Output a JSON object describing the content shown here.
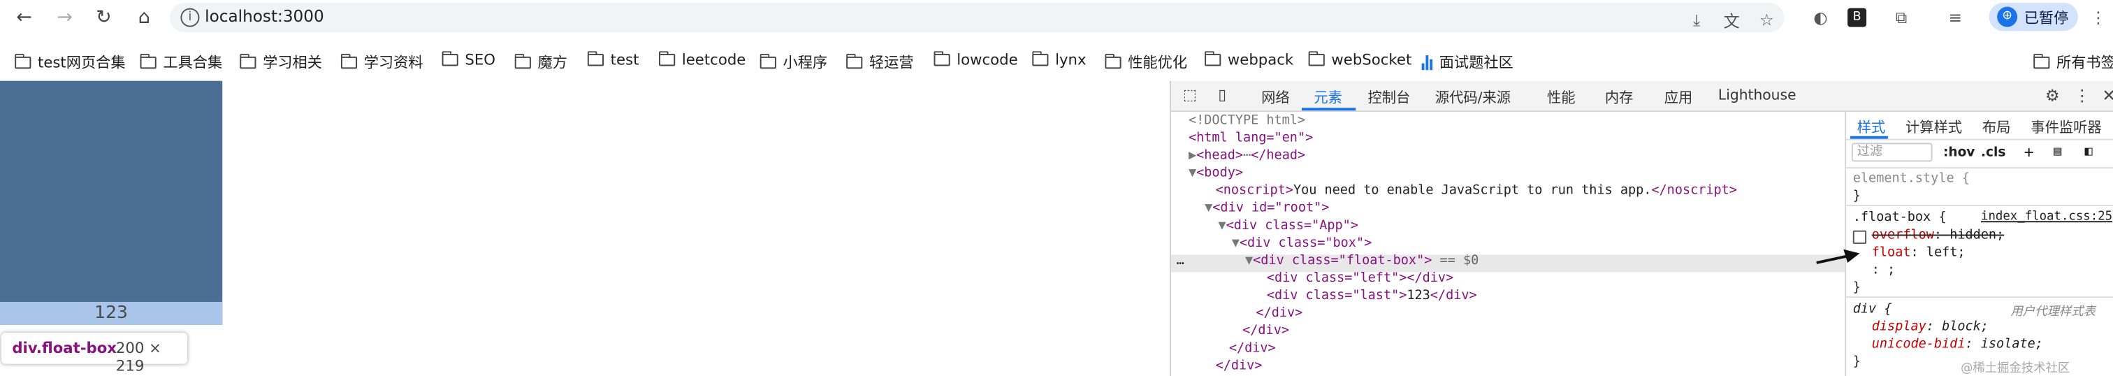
{
  "browser": {
    "url": "localhost:3000",
    "profile": {
      "avatar": "⊕",
      "status": "已暂停"
    }
  },
  "bookmarks": [
    "test网页合集",
    "工具合集",
    "学习相关",
    "学习资料",
    "SEO",
    "魔方",
    "test",
    "leetcode",
    "小程序",
    "轻运营",
    "lowcode",
    "lynx",
    "性能优化",
    "webpack",
    "webSocket",
    "面试题社区"
  ],
  "bookmarks_all": "所有书签",
  "page": {
    "last_text": "123",
    "tooltip": {
      "name": "div.float-box",
      "size": "200 × 219"
    }
  },
  "devtools": {
    "tabs": [
      "网络",
      "元素",
      "控制台",
      "源代码/来源",
      "性能",
      "内存",
      "应用",
      "Lighthouse"
    ],
    "active_tab": "元素",
    "dom": {
      "doctype": "<!DOCTYPE html>",
      "html_open": "<html lang=\"en\">",
      "head": "<head>",
      "head_ellipsis": "⋯",
      "head_close": "</head>",
      "body_open": "<body>",
      "noscript_open": "<noscript>",
      "noscript_text": "You need to enable JavaScript to run this app.",
      "noscript_close": "</noscript>",
      "root_open": "<div id=\"root\">",
      "app_open": "<div class=\"App\">",
      "box_open": "<div class=\"box\">",
      "float_open": "<div class=\"float-box\">",
      "float_marker": "== $0",
      "left_line": "<div class=\"left\"></div>",
      "last_open": "<div class=\"last\">",
      "last_text": "123",
      "last_close": "</div>",
      "close_div": "</div>",
      "row_dots": "…"
    },
    "styles": {
      "tabs": [
        "样式",
        "计算样式",
        "布局",
        "事件监听器"
      ],
      "filter_placeholder": "过滤",
      "hov": ":hov",
      "cls": ".cls",
      "element_style": "element.style {",
      "close_brace": "}",
      "float_selector": ".float-box {",
      "float_source": "index_float.css:25",
      "overflow_prop": "overflow",
      "overflow_val": "hidden;",
      "float_prop": "float",
      "float_val": "left;",
      "empty_decl": ": ;",
      "div_selector": "div {",
      "ua_label": "用户代理样式表",
      "display_prop": "display",
      "display_val": "block;",
      "unicode_prop": "unicode-bidi",
      "unicode_val": "isolate;"
    }
  },
  "watermark": "@稀土掘金技术社区",
  "colors": {
    "float_box": "#4a6e94",
    "last_row": "#a9c5ea",
    "accent": "#1a73e8"
  }
}
